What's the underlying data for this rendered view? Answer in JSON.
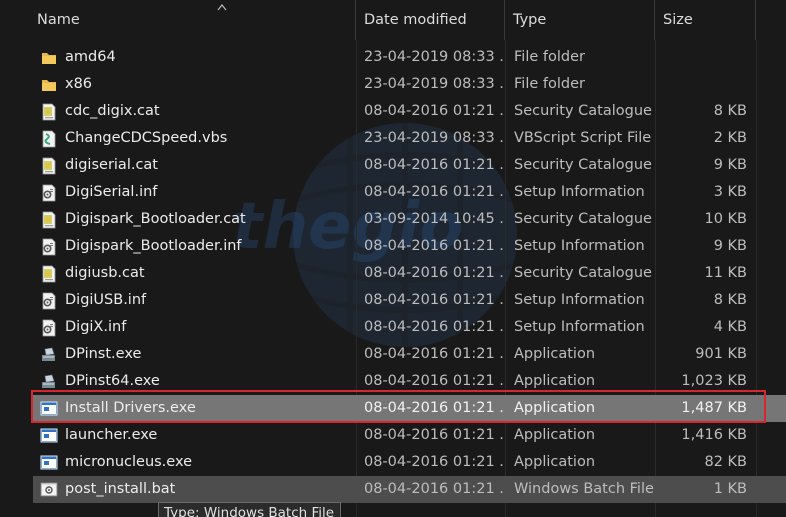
{
  "columns": {
    "name": "Name",
    "date": "Date modified",
    "type": "Type",
    "size": "Size"
  },
  "files": [
    {
      "name": "amd64",
      "date": "23-04-2019 08:33 ...",
      "type": "File folder",
      "size": "",
      "icon": "folder-icon"
    },
    {
      "name": "x86",
      "date": "23-04-2019 08:33 ...",
      "type": "File folder",
      "size": "",
      "icon": "folder-icon"
    },
    {
      "name": "cdc_digix.cat",
      "date": "08-04-2016 01:21 ...",
      "type": "Security Catalogue",
      "size": "8 KB",
      "icon": "catalogue-icon"
    },
    {
      "name": "ChangeCDCSpeed.vbs",
      "date": "23-04-2019 08:33 ...",
      "type": "VBScript Script File",
      "size": "2 KB",
      "icon": "script-icon"
    },
    {
      "name": "digiserial.cat",
      "date": "08-04-2016 01:21 ...",
      "type": "Security Catalogue",
      "size": "9 KB",
      "icon": "catalogue-icon"
    },
    {
      "name": "DigiSerial.inf",
      "date": "08-04-2016 01:21 ...",
      "type": "Setup Information",
      "size": "3 KB",
      "icon": "setup-info-icon"
    },
    {
      "name": "Digispark_Bootloader.cat",
      "date": "03-09-2014 10:45 ...",
      "type": "Security Catalogue",
      "size": "10 KB",
      "icon": "catalogue-icon"
    },
    {
      "name": "Digispark_Bootloader.inf",
      "date": "08-04-2016 01:21 ...",
      "type": "Setup Information",
      "size": "9 KB",
      "icon": "setup-info-icon"
    },
    {
      "name": "digiusb.cat",
      "date": "08-04-2016 01:21 ...",
      "type": "Security Catalogue",
      "size": "11 KB",
      "icon": "catalogue-icon"
    },
    {
      "name": "DigiUSB.inf",
      "date": "08-04-2016 01:21 ...",
      "type": "Setup Information",
      "size": "8 KB",
      "icon": "setup-info-icon"
    },
    {
      "name": "DigiX.inf",
      "date": "08-04-2016 01:21 ...",
      "type": "Setup Information",
      "size": "4 KB",
      "icon": "setup-info-icon"
    },
    {
      "name": "DPinst.exe",
      "date": "08-04-2016 01:21 ...",
      "type": "Application",
      "size": "901 KB",
      "icon": "installer-icon"
    },
    {
      "name": "DPinst64.exe",
      "date": "08-04-2016 01:21 ...",
      "type": "Application",
      "size": "1,023 KB",
      "icon": "installer-icon"
    },
    {
      "name": "Install Drivers.exe",
      "date": "08-04-2016 01:21 ...",
      "type": "Application",
      "size": "1,487 KB",
      "icon": "application-icon",
      "state": "selected"
    },
    {
      "name": "launcher.exe",
      "date": "08-04-2016 01:21 ...",
      "type": "Application",
      "size": "1,416 KB",
      "icon": "application-icon"
    },
    {
      "name": "micronucleus.exe",
      "date": "08-04-2016 01:21 ...",
      "type": "Application",
      "size": "82 KB",
      "icon": "application-icon"
    },
    {
      "name": "post_install.bat",
      "date": "08-04-2016 01:21 ...",
      "type": "Windows Batch File",
      "size": "1 KB",
      "icon": "batch-file-icon",
      "state": "hover"
    }
  ],
  "tooltip": "Type: Windows Batch File",
  "colors": {
    "background": "#191919",
    "selected": "#767676",
    "hover": "#4d4d4d",
    "highlight": "#d7262d",
    "folder": "#e8b74a"
  }
}
